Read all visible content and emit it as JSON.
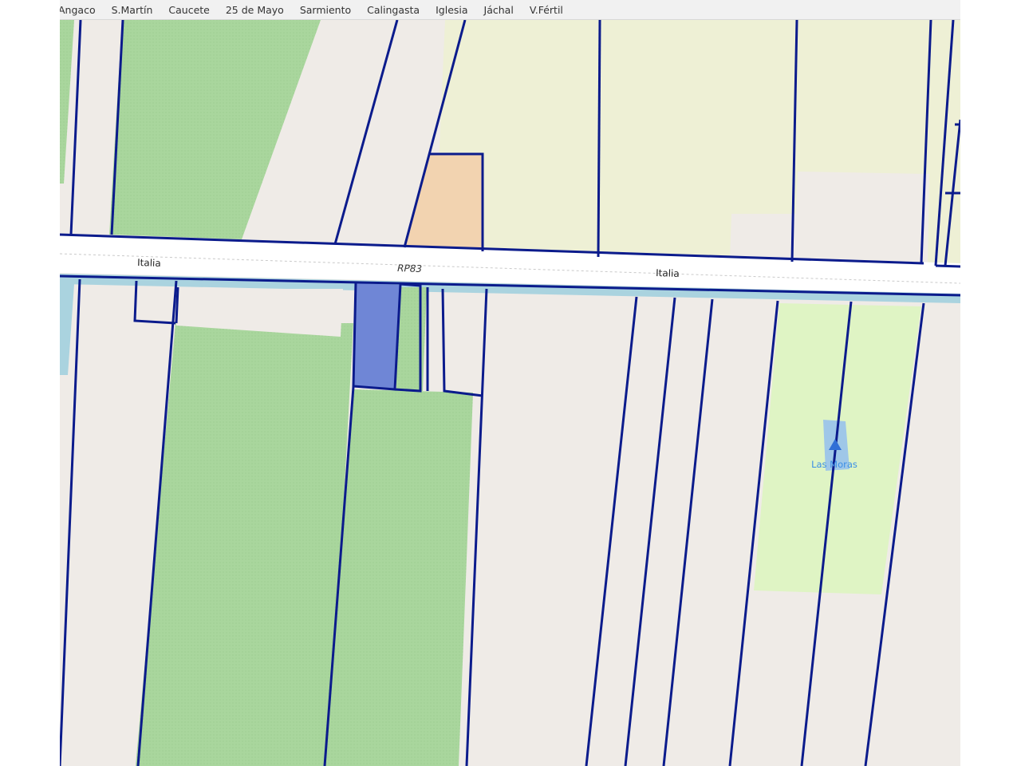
{
  "toolbar": {
    "departments": [
      {
        "label": "Angaco"
      },
      {
        "label": "S.Martín"
      },
      {
        "label": "Caucete"
      },
      {
        "label": "25 de Mayo"
      },
      {
        "label": "Sarmiento"
      },
      {
        "label": "Calingasta"
      },
      {
        "label": "Iglesia"
      },
      {
        "label": "Jáchal"
      },
      {
        "label": "V.Fértil"
      }
    ]
  },
  "map": {
    "roads": {
      "left_label": "Italia",
      "right_label": "Italia",
      "ref": "RP83"
    },
    "poi": {
      "label": "Las Moras",
      "icon": "campsite-triangle-icon"
    },
    "colors": {
      "parcel_outline": "#0b1b8c",
      "vineyard": "#aad7a0",
      "farmland": "#eef0d5",
      "grass": "#dff4c4",
      "commercial": "#f2d3b0",
      "selected_parcel": "#6f86d6",
      "canal": "#aad3df",
      "background": "#efebe7"
    }
  }
}
